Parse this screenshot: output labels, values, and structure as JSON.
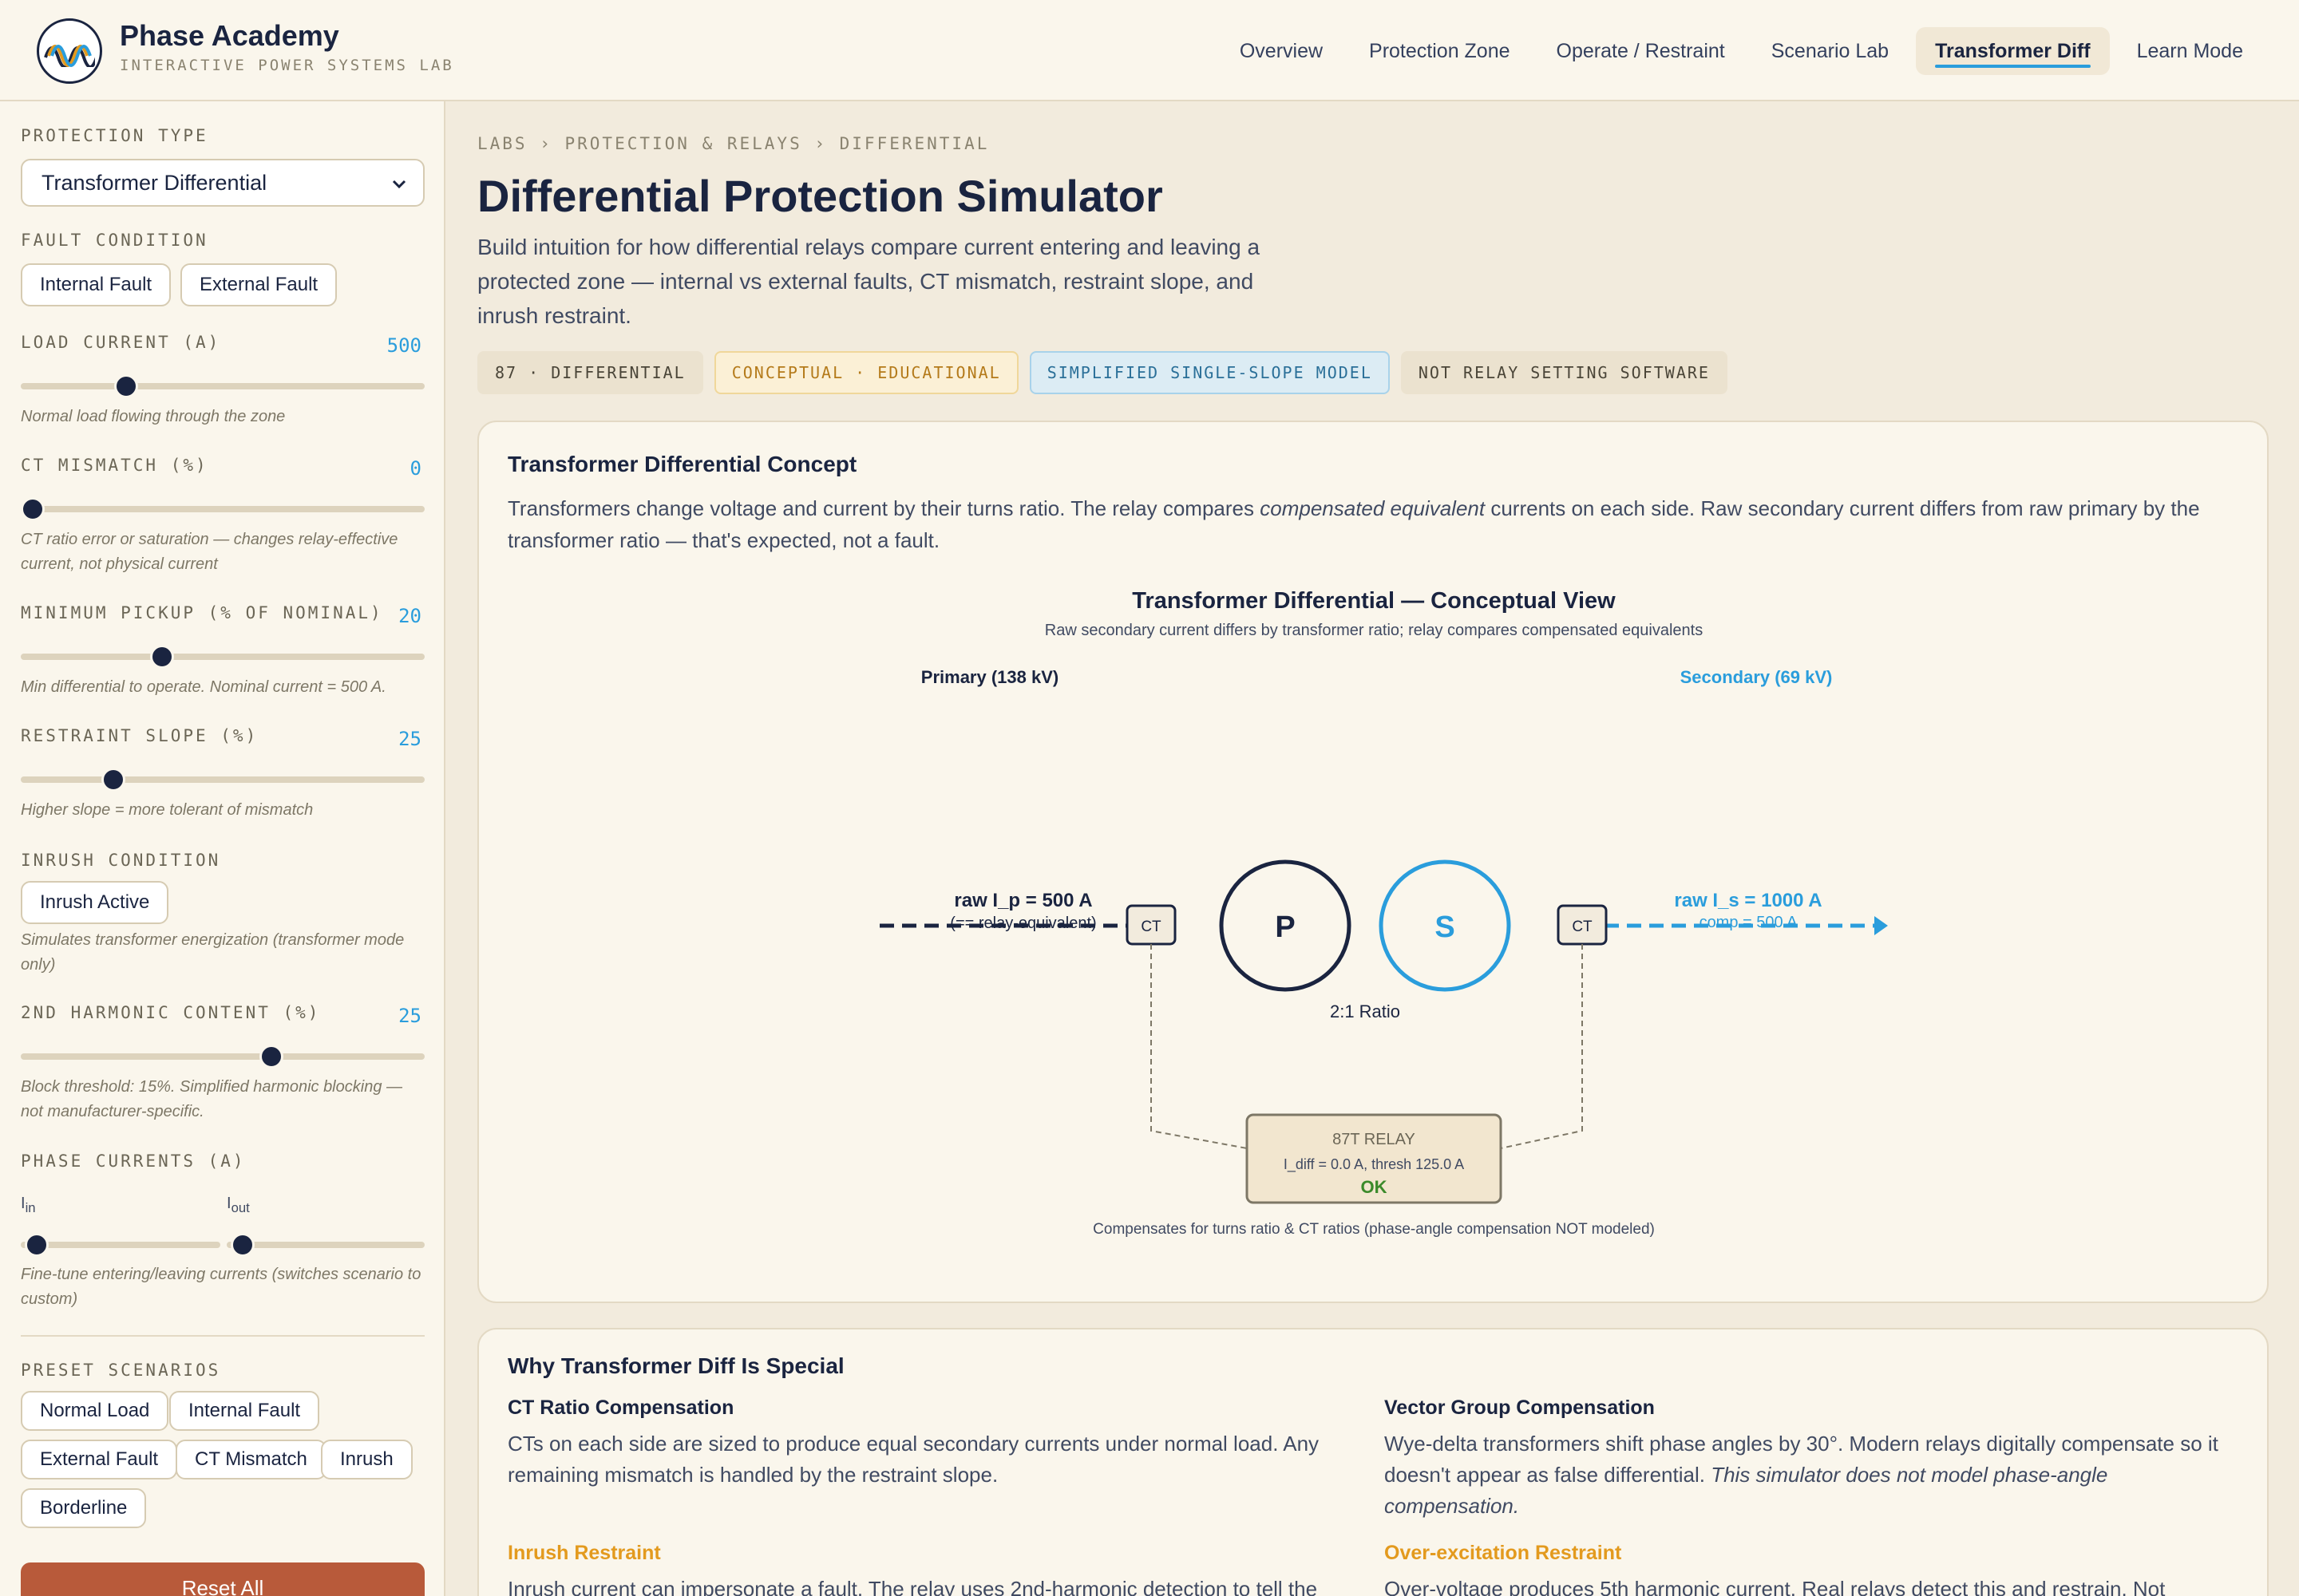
{
  "brand": {
    "title": "Phase Academy",
    "subtitle": "INTERACTIVE POWER SYSTEMS LAB",
    "logo_icon": "sine-waves-logo-icon"
  },
  "nav": {
    "items": [
      {
        "label": "Overview"
      },
      {
        "label": "Protection Zone"
      },
      {
        "label": "Operate / Restraint"
      },
      {
        "label": "Scenario Lab"
      },
      {
        "label": "Transformer Diff",
        "active": true
      },
      {
        "label": "Learn Mode"
      }
    ]
  },
  "sidebar": {
    "protection_type": {
      "label": "PROTECTION TYPE",
      "selected": "Transformer Differential"
    },
    "fault_condition": {
      "label": "FAULT CONDITION",
      "internal": "Internal Fault",
      "external": "External Fault"
    },
    "load_current": {
      "label": "LOAD CURRENT (A)",
      "value": "500",
      "level": 0.26,
      "help": "Normal load flowing through the zone"
    },
    "ct_mismatch": {
      "label": "CT MISMATCH (%)",
      "value": "0",
      "level": 0.03,
      "help": "CT ratio error or saturation — changes relay-effective current, not physical current"
    },
    "min_pickup": {
      "label": "MINIMUM PICKUP (% OF NOMINAL)",
      "value": "20",
      "level": 0.35,
      "help": "Min differential to operate. Nominal current = 500 A."
    },
    "restraint_slope": {
      "label": "RESTRAINT SLOPE (%)",
      "value": "25",
      "level": 0.23,
      "help": "Higher slope = more tolerant of mismatch"
    },
    "inrush": {
      "label": "INRUSH CONDITION",
      "button": "Inrush Active",
      "help": "Simulates transformer energization (transformer mode only)"
    },
    "harmonic": {
      "label": "2ND HARMONIC CONTENT (%)",
      "value": "25",
      "level": 0.62,
      "help": "Block threshold: 15%. Simplified harmonic blocking — not manufacturer-specific."
    },
    "phase_currents": {
      "label": "PHASE CURRENTS (A)",
      "in_label": "I",
      "in_sub": "in",
      "in_level": 0.08,
      "out_label": "I",
      "out_sub": "out",
      "out_level": 0.08,
      "help": "Fine-tune entering/leaving currents (switches scenario to custom)"
    },
    "presets": {
      "label": "PRESET SCENARIOS",
      "items": [
        "Normal Load",
        "Internal Fault",
        "External Fault",
        "CT Mismatch",
        "Inrush",
        "Borderline"
      ]
    },
    "reset": "Reset All"
  },
  "main": {
    "breadcrumb": "LABS › PROTECTION & RELAYS › DIFFERENTIAL",
    "title": "Differential Protection Simulator",
    "lede": "Build intuition for how differential relays compare current entering and leaving a protected zone — internal vs external faults, CT mismatch, restraint slope, and inrush restraint.",
    "tags": [
      "87 · DIFFERENTIAL",
      "CONCEPTUAL · EDUCATIONAL",
      "SIMPLIFIED SINGLE-SLOPE MODEL",
      "NOT RELAY SETTING SOFTWARE"
    ]
  },
  "concept": {
    "title": "Transformer Differential Concept",
    "text_pre": "Transformers change voltage and current by their turns ratio. The relay compares ",
    "text_em": "compensated equivalent",
    "text_post": " currents on each side. Raw secondary current differs from raw primary by the transformer ratio — that's expected, not a fault.",
    "diagram": {
      "title": "Transformer Differential — Conceptual View",
      "subtitle": "Raw secondary current differs by transformer ratio; relay compares compensated equivalents",
      "primary_label": "Primary (138 kV)",
      "secondary_label": "Secondary (69 kV)",
      "raw_primary": "raw I_p = 500 A",
      "raw_primary_note": "(== relay-equivalent)",
      "raw_secondary": "raw I_s = 1000 A",
      "comp_secondary": "comp = 500 A",
      "ct_label": "CT",
      "p_winding": "P",
      "s_winding": "S",
      "ratio": "2:1 Ratio",
      "relay_title": "87T RELAY",
      "relay_values": "I_diff = 0.0 A, thresh 125.0 A",
      "relay_status": "OK",
      "footnote": "Compensates for turns ratio & CT ratios (phase-angle compensation NOT modeled)",
      "colors": {
        "primary": "#1a2440",
        "secondary": "#2a9ddc",
        "ok": "#3b8a2a"
      }
    }
  },
  "why": {
    "title": "Why Transformer Diff Is Special",
    "ct_title": "CT Ratio Compensation",
    "ct_text": "CTs on each side are sized to produce equal secondary currents under normal load. Any remaining mismatch is handled by the restraint slope.",
    "vector_title": "Vector Group Compensation",
    "vector_text": "Wye-delta transformers shift phase angles by 30°. Modern relays digitally compensate so it doesn't appear as false differential. ",
    "vector_em": "This simulator does not model phase-angle compensation.",
    "inrush_title": "Inrush Restraint",
    "inrush_text": "Inrush current can impersonate a fault. The relay uses 2nd-harmonic detection to tell the",
    "overex_title": "Over-excitation Restraint",
    "overex_text": "Over-voltage produces 5th harmonic current. Real relays detect this and restrain. Not"
  }
}
